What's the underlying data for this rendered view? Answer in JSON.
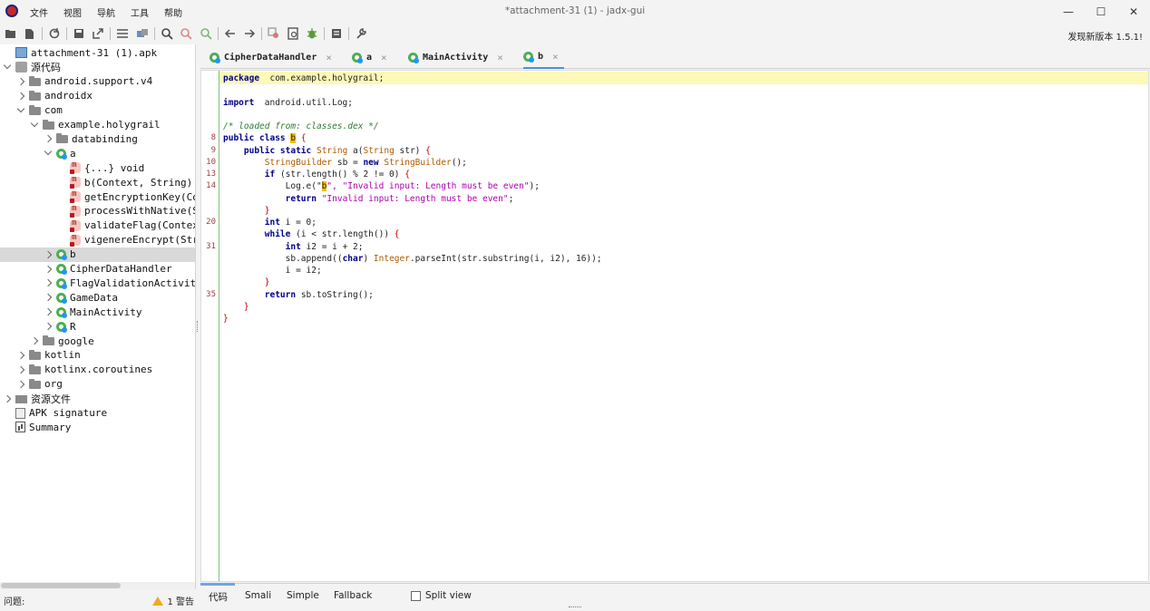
{
  "window": {
    "title": "*attachment-31 (1) - jadx-gui",
    "minimize_glyph": "—",
    "maximize_glyph": "☐",
    "close_glyph": "✕"
  },
  "menu": [
    "文件",
    "视图",
    "导航",
    "工具",
    "帮助"
  ],
  "toolbar": {
    "icons": [
      "open-file-icon",
      "add-files-icon",
      "reload-icon",
      "save-all-icon",
      "export-icon",
      "sync-tree-icon",
      "flatten-packages-icon",
      "search-icon",
      "find-usage-icon",
      "find-class-icon",
      "back-icon",
      "forward-icon",
      "deobfuscation-icon",
      "quick-tabs-icon",
      "debug-icon",
      "log-icon",
      "preferences-icon"
    ],
    "update_text": "发现新版本 1.5.1!"
  },
  "tree": {
    "nodes": [
      {
        "label": "attachment-31 (1).apk",
        "icon": "apk",
        "arrow": "n",
        "indent": 0
      },
      {
        "label": "源代码",
        "icon": "src",
        "arrow": "d",
        "indent": 0
      },
      {
        "label": "android.support.v4",
        "icon": "pkg",
        "arrow": "r",
        "indent": 1
      },
      {
        "label": "androidx",
        "icon": "pkg",
        "arrow": "r",
        "indent": 1
      },
      {
        "label": "com",
        "icon": "pkg",
        "arrow": "d",
        "indent": 1
      },
      {
        "label": "example.holygrail",
        "icon": "pkg",
        "arrow": "d",
        "indent": 2
      },
      {
        "label": "databinding",
        "icon": "pkg",
        "arrow": "r",
        "indent": 3
      },
      {
        "label": "a",
        "icon": "cls",
        "arrow": "d",
        "indent": 3
      },
      {
        "label": "{...} void",
        "icon": "mth",
        "arrow": "n",
        "indent": 4
      },
      {
        "label": "b(Context, String)",
        "icon": "mth",
        "arrow": "n",
        "indent": 4
      },
      {
        "label": "getEncryptionKey(Co",
        "icon": "mth",
        "arrow": "n",
        "indent": 4
      },
      {
        "label": "processWithNative(S",
        "icon": "mth",
        "arrow": "n",
        "indent": 4
      },
      {
        "label": "validateFlag(Contex",
        "icon": "mth",
        "arrow": "n",
        "indent": 4
      },
      {
        "label": "vigenereEncrypt(Str",
        "icon": "mth",
        "arrow": "n",
        "indent": 4
      },
      {
        "label": "b",
        "icon": "cls",
        "arrow": "r",
        "indent": 3,
        "selected": true
      },
      {
        "label": "CipherDataHandler",
        "icon": "cls",
        "arrow": "r",
        "indent": 3
      },
      {
        "label": "FlagValidationActivit",
        "icon": "cls",
        "arrow": "r",
        "indent": 3
      },
      {
        "label": "GameData",
        "icon": "cls",
        "arrow": "r",
        "indent": 3
      },
      {
        "label": "MainActivity",
        "icon": "cls",
        "arrow": "r",
        "indent": 3
      },
      {
        "label": "R",
        "icon": "cls",
        "arrow": "r",
        "indent": 3
      },
      {
        "label": "google",
        "icon": "pkg",
        "arrow": "r",
        "indent": 2
      },
      {
        "label": "kotlin",
        "icon": "pkg",
        "arrow": "r",
        "indent": 1
      },
      {
        "label": "kotlinx.coroutines",
        "icon": "pkg",
        "arrow": "r",
        "indent": 1
      },
      {
        "label": "org",
        "icon": "pkg",
        "arrow": "r",
        "indent": 1
      },
      {
        "label": "资源文件",
        "icon": "res",
        "arrow": "r",
        "indent": 0
      },
      {
        "label": "APK signature",
        "icon": "sig",
        "arrow": "n",
        "indent": 0
      },
      {
        "label": "Summary",
        "icon": "sum",
        "arrow": "n",
        "indent": 0
      }
    ]
  },
  "tabs": [
    {
      "label": "CipherDataHandler",
      "active": false
    },
    {
      "label": "a",
      "active": false
    },
    {
      "label": "MainActivity",
      "active": false
    },
    {
      "label": "b",
      "active": true
    }
  ],
  "tab_close_glyph": "×",
  "code": {
    "line_numbers": [
      "",
      "",
      "",
      "",
      "",
      "8",
      "9",
      "10",
      "13",
      "14",
      "",
      "",
      "20",
      "",
      "31",
      "",
      "",
      "",
      "35",
      "",
      ""
    ],
    "lines": [
      [
        [
          "kw",
          "package"
        ],
        [
          "",
          "  com.example.holygrail;"
        ]
      ],
      [],
      [
        [
          "kw",
          "import"
        ],
        [
          "",
          "  android.util.Log;"
        ]
      ],
      [],
      [
        [
          "cm",
          "/* loaded from: classes.dex */"
        ]
      ],
      [
        [
          "kw",
          "public class "
        ],
        [
          "mk",
          "b"
        ],
        [
          "pn",
          " {"
        ]
      ],
      [
        [
          "",
          "    "
        ],
        [
          "kw",
          "public static "
        ],
        [
          "ty",
          "String"
        ],
        [
          "",
          " a("
        ],
        [
          "ty",
          "String"
        ],
        [
          "",
          " str) "
        ],
        [
          "pn",
          "{"
        ]
      ],
      [
        [
          "",
          "        "
        ],
        [
          "ty",
          "StringBuilder"
        ],
        [
          "",
          " sb = "
        ],
        [
          "kw",
          "new "
        ],
        [
          "ty",
          "StringBuilder"
        ],
        [
          "",
          "();"
        ]
      ],
      [
        [
          "",
          "        "
        ],
        [
          "kw",
          "if"
        ],
        [
          "",
          " (str.length() % 2 != 0) "
        ],
        [
          "pn",
          "{"
        ]
      ],
      [
        [
          "",
          "            Log.e(\""
        ],
        [
          "mk",
          "b"
        ],
        [
          "str",
          "\", \"Invalid input: Length must be even\""
        ],
        [
          "",
          ");"
        ]
      ],
      [
        [
          "",
          "            "
        ],
        [
          "kw",
          "return "
        ],
        [
          "str",
          "\"Invalid input: Length must be even\""
        ],
        [
          "",
          ";"
        ]
      ],
      [
        [
          "",
          "        "
        ],
        [
          "pn",
          "}"
        ]
      ],
      [
        [
          "",
          "        "
        ],
        [
          "kw",
          "int"
        ],
        [
          "",
          " i = 0;"
        ]
      ],
      [
        [
          "",
          "        "
        ],
        [
          "kw",
          "while"
        ],
        [
          "",
          " (i < str.length()) "
        ],
        [
          "pn",
          "{"
        ]
      ],
      [
        [
          "",
          "            "
        ],
        [
          "kw",
          "int"
        ],
        [
          "",
          " i2 = i + 2;"
        ]
      ],
      [
        [
          "",
          "            sb.append(("
        ],
        [
          "kw",
          "char"
        ],
        [
          "",
          ") "
        ],
        [
          "ty",
          "Integer"
        ],
        [
          "",
          ".parseInt(str.substring(i, i2), 16));"
        ]
      ],
      [
        [
          "",
          "            i = i2;"
        ]
      ],
      [
        [
          "",
          "        "
        ],
        [
          "pn",
          "}"
        ]
      ],
      [
        [
          "",
          "        "
        ],
        [
          "kw",
          "return"
        ],
        [
          "",
          " sb.toString();"
        ]
      ],
      [
        [
          "",
          "    "
        ],
        [
          "pn",
          "}"
        ]
      ],
      [
        [
          "pn",
          "}"
        ]
      ]
    ]
  },
  "bottom_tabs": [
    "代码",
    "Smali",
    "Simple",
    "Fallback"
  ],
  "split_view_label": "Split view",
  "status": {
    "label": "问题:",
    "warning": "1 警告"
  }
}
